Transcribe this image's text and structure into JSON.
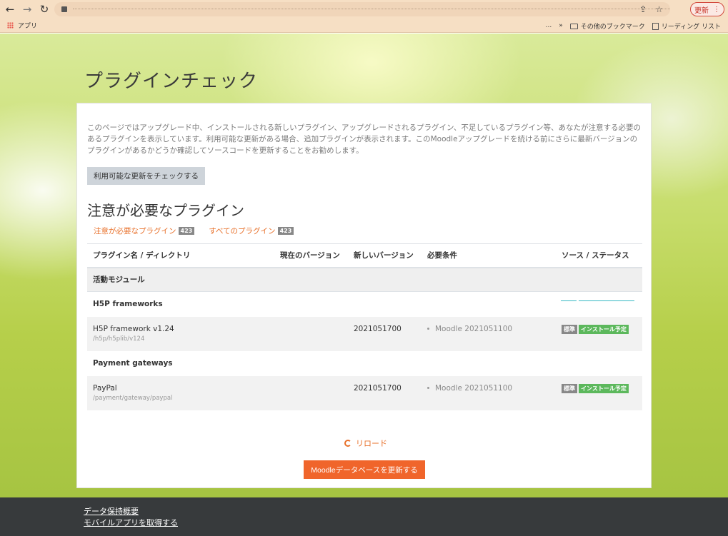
{
  "browser": {
    "update_label": "更新",
    "bookmarks": {
      "apps_label": "アプリ",
      "overflow": "...",
      "more": "»",
      "other_bookmarks": "その他のブックマーク",
      "reading_list": "リーディング リスト"
    }
  },
  "page": {
    "title": "プラグインチェック",
    "intro": "このページではアップグレード中、インストールされる新しいプラグイン、アップグレードされるプラグイン、不足しているプラグイン等、あなたが注意する必要のあるプラグインを表示しています。利用可能な更新がある場合、追加プラグインが表示されます。このMoodleアップグレードを続ける前にさらに最新バージョンのプラグインがあるかどうか確認してソースコードを更新することをお勧めします。",
    "check_button": "利用可能な更新をチェックする",
    "section_title": "注意が必要なプラグイン",
    "filters": [
      {
        "label": "注意が必要なプラグイン",
        "count": "423"
      },
      {
        "label": "すべてのプラグイン",
        "count": "423"
      }
    ],
    "table": {
      "headers": [
        "プラグイン名 / ディレクトリ",
        "現在のバージョン",
        "新しいバージョン",
        "必要条件",
        "ソース / ステータス"
      ],
      "category": "活動モジュール",
      "groups": [
        {
          "name": "H5P frameworks",
          "plugin": {
            "name": "H5P framework v1.24",
            "dir": "/h5p/h5plib/v124",
            "new_version": "2021051700",
            "requirement": "Moodle 2021051100",
            "tag_source": "標準",
            "tag_status": "インストール予定"
          }
        },
        {
          "name": "Payment gateways",
          "plugin": {
            "name": "PayPal",
            "dir": "/payment/gateway/paypal",
            "new_version": "2021051700",
            "requirement": "Moodle 2021051100",
            "tag_source": "標準",
            "tag_status": "インストール予定"
          }
        }
      ]
    },
    "reload_label": "リロード",
    "upgrade_button": "Moodleデータベースを更新する"
  },
  "footer": {
    "links": [
      "データ保持概要",
      "モバイルアプリを取得する"
    ]
  },
  "colors": {
    "accent": "#e8702a",
    "primary_button": "#f0652b",
    "install_tag": "#5cb85c",
    "footer_bg": "#373a3c"
  }
}
